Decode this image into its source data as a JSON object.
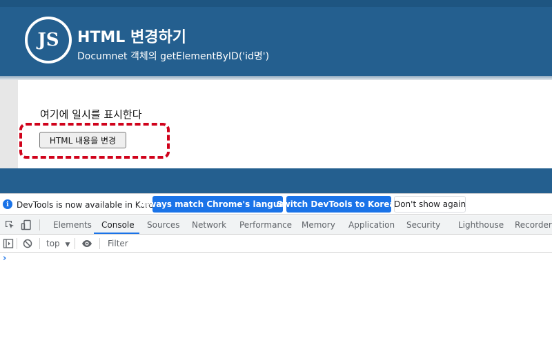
{
  "page": {
    "logo_text": "JS",
    "title": "HTML 변경하기",
    "subtitle": "Documnet 객체의 getElementByID('id명')",
    "display_text": "여기에 일시를 표시한다",
    "button_label": "HTML 내용을 변경"
  },
  "devtools": {
    "infobar": {
      "message": "DevTools is now available in Korean!",
      "match_label": "Always match Chrome's language",
      "switch_label": "Switch DevTools to Korean",
      "dont_show_label": "Don't show again"
    },
    "tabs": [
      {
        "label": "Elements"
      },
      {
        "label": "Console"
      },
      {
        "label": "Sources"
      },
      {
        "label": "Network"
      },
      {
        "label": "Performance"
      },
      {
        "label": "Memory"
      },
      {
        "label": "Application"
      },
      {
        "label": "Security"
      },
      {
        "label": "Lighthouse"
      },
      {
        "label": "Recorder"
      }
    ],
    "active_tab": "Console",
    "console": {
      "context": "top",
      "filter_placeholder": "Filter",
      "prompt": "›"
    }
  },
  "colors": {
    "header_bg": "#245f8f",
    "accent_blue": "#1a73e8",
    "dashed_highlight": "#d0021b"
  },
  "icons": [
    "info-icon",
    "inspect-element-icon",
    "device-toolbar-icon",
    "sidebar-toggle-icon",
    "clear-console-icon",
    "eye-icon",
    "dropdown-caret-icon"
  ]
}
